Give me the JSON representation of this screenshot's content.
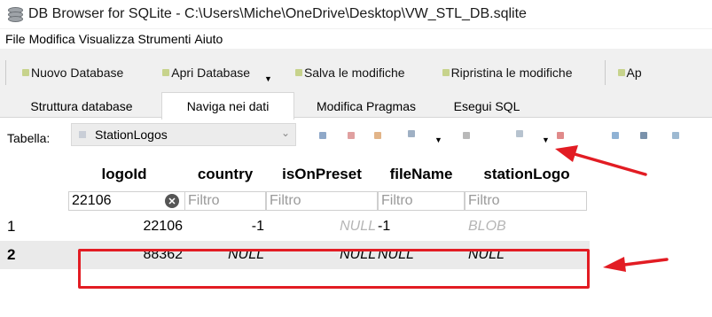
{
  "window": {
    "title": "DB Browser for SQLite - C:\\Users\\Miche\\OneDrive\\Desktop\\VW_STL_DB.sqlite"
  },
  "menu": [
    "File",
    "Modifica",
    "Visualizza",
    "Strumenti",
    "Aiuto"
  ],
  "toolbar": {
    "new_db": "Nuovo Database",
    "open_db": "Apri Database",
    "save": "Salva le modifiche",
    "revert": "Ripristina le modifiche",
    "extra": "Ap"
  },
  "tabs": [
    "Struttura database",
    "Naviga nei dati",
    "Modifica Pragmas",
    "Esegui SQL"
  ],
  "table_selector": {
    "label": "Tabella:",
    "value": "StationLogos"
  },
  "grid": {
    "columns": [
      "logoId",
      "country",
      "isOnPreset",
      "fileName",
      "stationLogo"
    ],
    "filters": {
      "logoId_value": "22106",
      "placeholder": "Filtro"
    },
    "rows": [
      {
        "num": "1",
        "logoId": "22106",
        "country": "-1",
        "isOnPreset": "NULL",
        "fileName": "-1",
        "stationLogo": "BLOB"
      },
      {
        "num": "2",
        "logoId": "88362",
        "country": "NULL",
        "isOnPreset": "NULL",
        "fileName": "NULL",
        "stationLogo": "NULL"
      }
    ]
  },
  "colors": {
    "highlight": "#e21c23",
    "selected_row": "#eaeaea"
  }
}
